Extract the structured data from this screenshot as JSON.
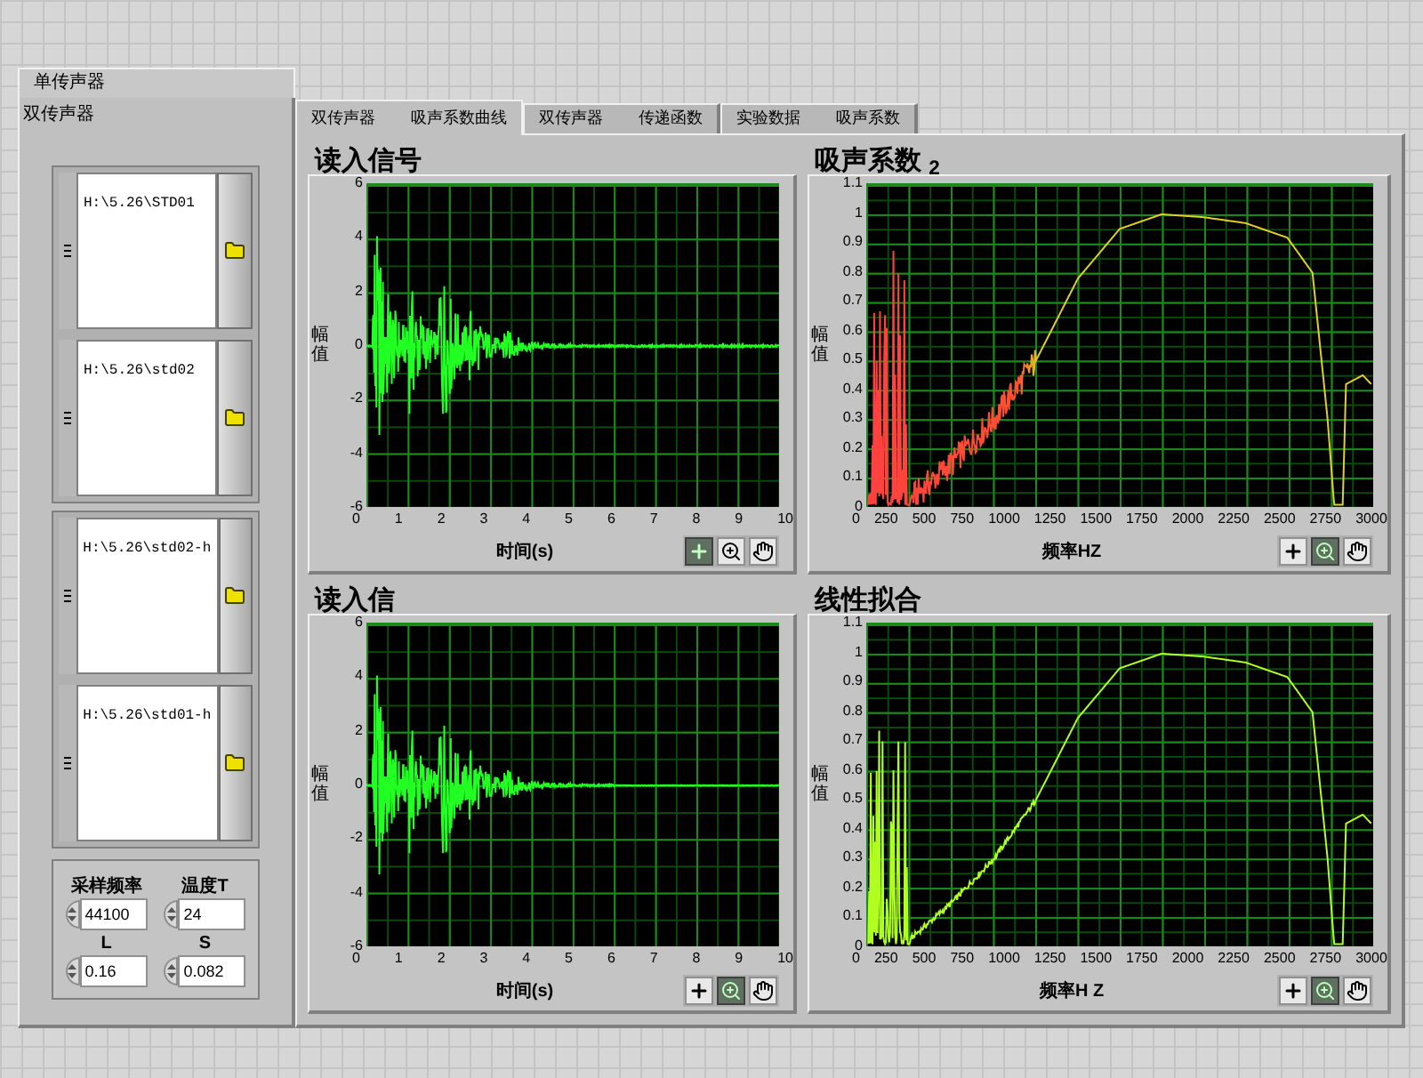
{
  "outer_tab": {
    "label": "单传声器"
  },
  "panel": {
    "title": "双传声器"
  },
  "file_groups": [
    {
      "paths": [
        "H:\\5.26\\STD01",
        "H:\\5.26\\std02"
      ]
    },
    {
      "paths": [
        "H:\\5.26\\std02-h",
        "H:\\5.26\\std01-h"
      ]
    }
  ],
  "parameters": [
    {
      "label": "采样频率",
      "value": "44100"
    },
    {
      "label": "温度T",
      "value": "24"
    },
    {
      "label": "L",
      "value": "0.16"
    },
    {
      "label": "S",
      "value": "0.082"
    }
  ],
  "tabs": [
    {
      "labels": [
        "双传声器",
        "吸声系数曲线"
      ],
      "selected": true
    },
    {
      "labels": [
        "双传声器",
        "传递函数"
      ],
      "selected": false
    },
    {
      "labels": [
        "实验数据",
        "吸声系数"
      ],
      "selected": false
    }
  ],
  "graphs": [
    {
      "title": "读入信号",
      "kind": "signal",
      "ylabel": "幅值",
      "yticks": [
        "6",
        "4",
        "2",
        "0",
        "-2",
        "-4",
        "-6"
      ],
      "xticks": [
        "0",
        "1",
        "2",
        "3",
        "4",
        "5",
        "6",
        "7",
        "8",
        "9",
        "10"
      ],
      "xlabel": "时间(s)",
      "tools": [
        {
          "kind": "cursor",
          "selected": true
        },
        {
          "kind": "zoom",
          "selected": false
        },
        {
          "kind": "pan",
          "selected": false
        }
      ]
    },
    {
      "title": "吸声系数 $_{2}$",
      "kind": "absorption-noisy",
      "ylabel": "幅值",
      "yticks": [
        "1.1",
        "1",
        "0.9",
        "0.8",
        "0.7",
        "0.6",
        "0.5",
        "0.4",
        "0.3",
        "0.2",
        "0.1",
        "0"
      ],
      "xticks": [
        "0",
        "250",
        "500",
        "750",
        "1000",
        "1250",
        "1500",
        "1750",
        "2000",
        "2250",
        "2500",
        "2750",
        "3000"
      ],
      "xlabel": "频率HZ",
      "tools": [
        {
          "kind": "cursor",
          "selected": false
        },
        {
          "kind": "zoom",
          "selected": true
        },
        {
          "kind": "pan",
          "selected": false
        }
      ]
    },
    {
      "title": "读入信",
      "kind": "signal-short",
      "ylabel": "幅值",
      "yticks": [
        "6",
        "4",
        "2",
        "0",
        "-2",
        "-4",
        "-6"
      ],
      "xticks": [
        "0",
        "1",
        "2",
        "3",
        "4",
        "5",
        "6",
        "7",
        "8",
        "9",
        "10"
      ],
      "xlabel": "时间(s)",
      "tools": [
        {
          "kind": "cursor",
          "selected": false
        },
        {
          "kind": "zoom",
          "selected": true
        },
        {
          "kind": "pan",
          "selected": false
        }
      ]
    },
    {
      "title": "线性拟合",
      "kind": "absorption-smooth",
      "ylabel": "幅值",
      "yticks": [
        "1.1",
        "1",
        "0.9",
        "0.8",
        "0.7",
        "0.6",
        "0.5",
        "0.4",
        "0.3",
        "0.2",
        "0.1",
        "0"
      ],
      "xticks": [
        "0",
        "250",
        "500",
        "750",
        "1000",
        "1250",
        "1500",
        "1750",
        "2000",
        "2250",
        "2500",
        "2750",
        "3000"
      ],
      "xlabel": "频率H Z",
      "tools": [
        {
          "kind": "cursor",
          "selected": false
        },
        {
          "kind": "zoom",
          "selected": true
        },
        {
          "kind": "pan",
          "selected": false
        }
      ]
    }
  ]
}
